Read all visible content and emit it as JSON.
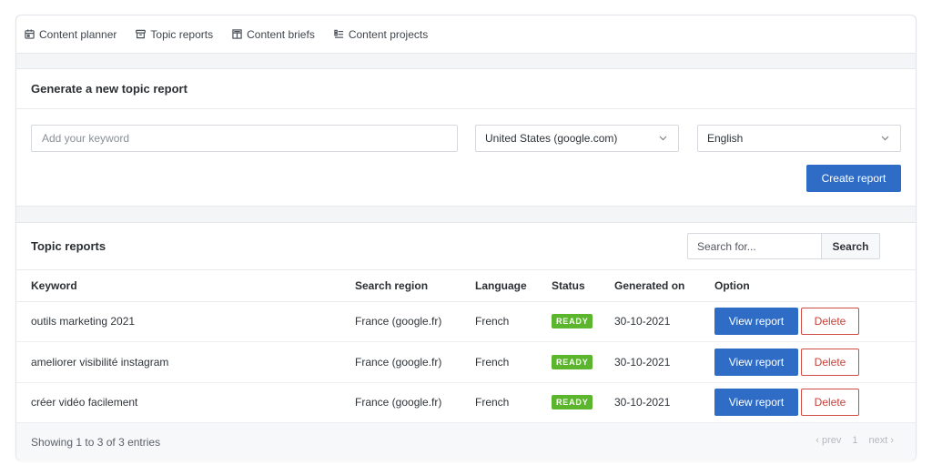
{
  "nav": {
    "items": [
      {
        "label": "Content planner",
        "icon": "calendar-icon"
      },
      {
        "label": "Topic reports",
        "icon": "archive-icon"
      },
      {
        "label": "Content briefs",
        "icon": "brief-icon"
      },
      {
        "label": "Content projects",
        "icon": "list-icon"
      }
    ]
  },
  "generate": {
    "title": "Generate a new topic report",
    "keyword_placeholder": "Add your keyword",
    "keyword_value": "",
    "region_selected": "United States (google.com)",
    "language_selected": "English",
    "create_label": "Create report"
  },
  "reports": {
    "title": "Topic reports",
    "search_placeholder": "Search for...",
    "search_label": "Search",
    "columns": [
      "Keyword",
      "Search region",
      "Language",
      "Status",
      "Generated on",
      "Option"
    ],
    "rows": [
      {
        "keyword": "outils marketing 2021",
        "region": "France (google.fr)",
        "language": "French",
        "status": "READY",
        "generated": "30-10-2021",
        "view": "View report",
        "delete": "Delete"
      },
      {
        "keyword": "ameliorer visibilité instagram",
        "region": "France (google.fr)",
        "language": "French",
        "status": "READY",
        "generated": "30-10-2021",
        "view": "View report",
        "delete": "Delete"
      },
      {
        "keyword": "créer vidéo facilement",
        "region": "France (google.fr)",
        "language": "French",
        "status": "READY",
        "generated": "30-10-2021",
        "view": "View report",
        "delete": "Delete"
      }
    ],
    "footer_text": "Showing 1 to 3 of 3 entries",
    "pager": {
      "prev": "‹ prev",
      "page": "1",
      "next": "next ›"
    }
  },
  "colors": {
    "primary": "#2f6cc5",
    "status_ready": "#5bb52d",
    "danger": "#c7403a"
  }
}
